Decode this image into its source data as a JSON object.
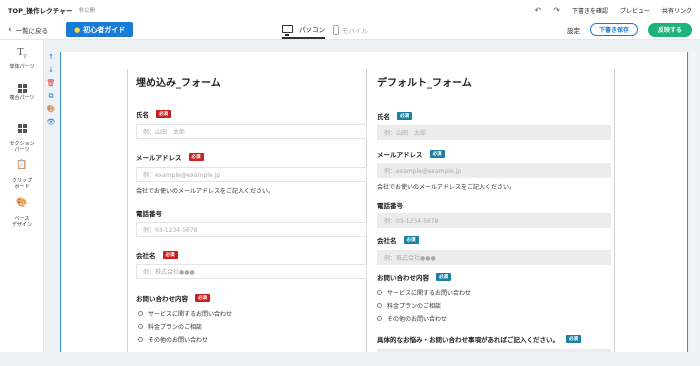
{
  "topbar": {
    "title": "TOP_操作レクチャー",
    "status": "非公開",
    "draft_confirm": "下書きを確認",
    "preview": "プレビュー",
    "share_link": "共有リンク"
  },
  "toolbar": {
    "back_label": "一覧に戻る",
    "guide_label": "初心者ガイド",
    "device_pc": "パソコン",
    "device_mobile": "モバイル",
    "settings": "設定",
    "save_draft": "下書き保存",
    "publish": "反映する"
  },
  "sidebar": {
    "items": [
      {
        "icon": "T",
        "label": "単体パーツ"
      },
      {
        "icon": "grid",
        "label": "複合パーツ"
      },
      {
        "icon": "grid",
        "label": "セクション\nパーツ"
      },
      {
        "icon": "clipboard",
        "label": "クリップ\nボード"
      },
      {
        "icon": "palette",
        "label": "ベース\nデザイン"
      }
    ]
  },
  "tools": [
    "↑",
    "↓",
    "🗑",
    "⧉",
    "🎨",
    "👁"
  ],
  "form_left": {
    "title": "埋め込み_フォーム",
    "required": "必須",
    "name_label": "氏名",
    "name_placeholder": "例：山田　太郎",
    "email_label": "メールアドレス",
    "email_placeholder": "例：example@example.jp",
    "email_note": "会社でお使いのメールアドレスをご記入ください。",
    "phone_label": "電話番号",
    "phone_placeholder": "例：03-1234-5678",
    "company_label": "会社名",
    "company_placeholder": "例：株式会社●●●",
    "inquiry_label": "お問い合わせ内容",
    "options": [
      "サービスに関するお問い合わせ",
      "料金プランのご相談",
      "その他のお問い合わせ"
    ]
  },
  "form_right": {
    "title": "デフォルト_フォーム",
    "required": "必須",
    "name_label": "氏名",
    "name_placeholder": "例：山田　太郎",
    "email_label": "メールアドレス",
    "email_placeholder": "例：example@example.jp",
    "email_note": "会社でお使いのメールアドレスをご記入ください。",
    "phone_label": "電話番号",
    "phone_placeholder": "例：03-1234-5678",
    "company_label": "会社名",
    "company_placeholder": "例：株式会社●●●",
    "inquiry_label": "お問い合わせ内容",
    "options": [
      "サービスに関するお問い合わせ",
      "料金プランのご相談",
      "その他のお問い合わせ"
    ],
    "concern_label": "具体的なお悩み・お問い合わせ事項があればご記入ください。"
  },
  "colors": {
    "accent_blue": "#1a7bd6",
    "publish_green": "#1fb37a",
    "required_red": "#cc1f1f",
    "required_teal": "#1f7fa0"
  }
}
